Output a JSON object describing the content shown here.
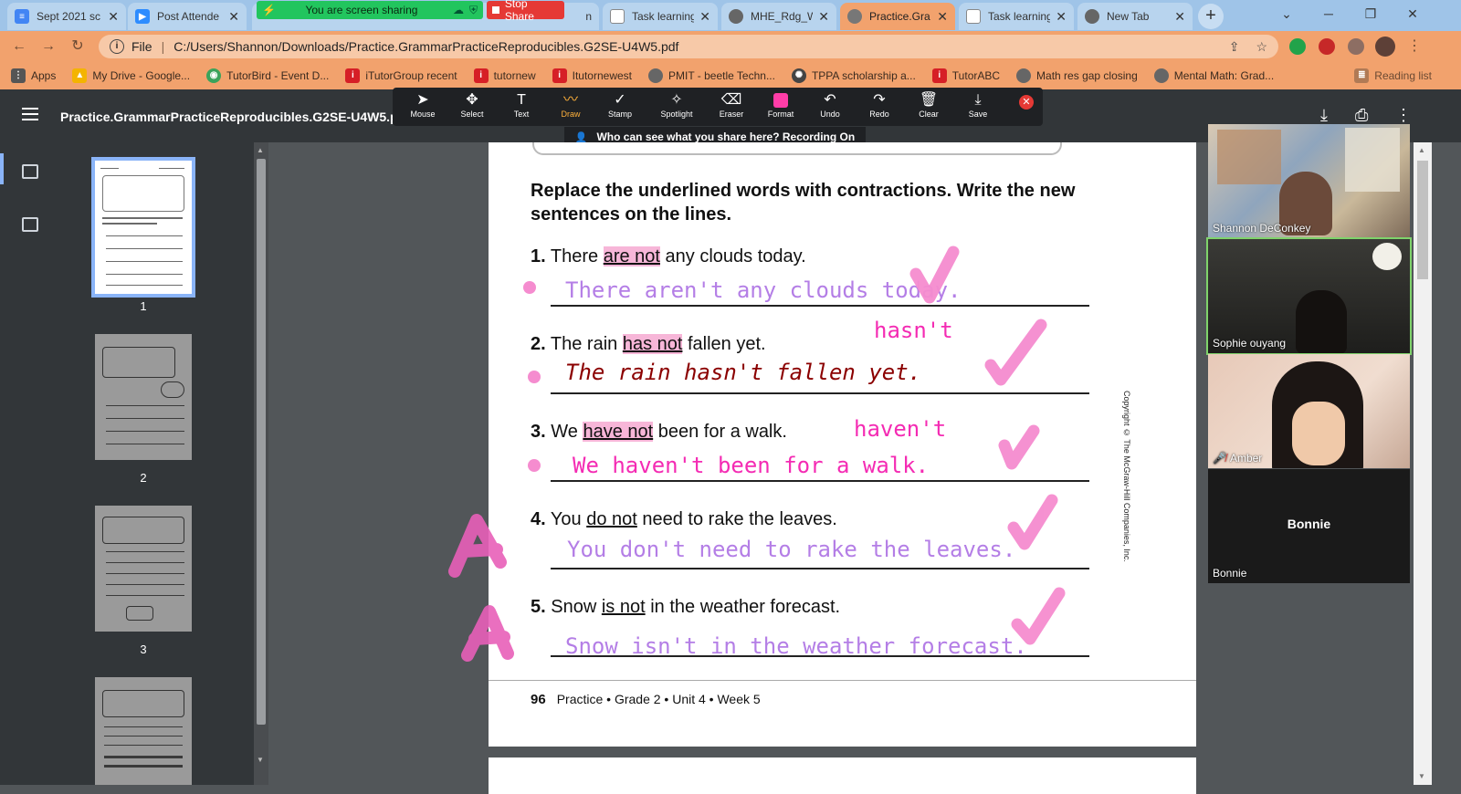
{
  "browser": {
    "tabs": [
      {
        "label": "Sept 2021 sc",
        "icon": "docs-icon",
        "color": "#4285f4"
      },
      {
        "label": "Post Attende",
        "icon": "zoom-icon",
        "color": "#2d8cff"
      },
      {
        "label": "n",
        "icon": "page-icon",
        "color": "#999999"
      },
      {
        "label": "Task learning",
        "icon": "doc-page-icon",
        "color": "#777777"
      },
      {
        "label": "MHE_Rdg_W",
        "icon": "globe-icon",
        "color": "#555555"
      },
      {
        "label": "Practice.Gra",
        "icon": "globe-icon",
        "color": "#555555"
      },
      {
        "label": "Task learning",
        "icon": "doc-page-icon",
        "color": "#777777"
      },
      {
        "label": "New Tab",
        "icon": "globe-icon",
        "color": "#555555"
      }
    ],
    "share_banner": "You are screen sharing",
    "stop_share": "Stop Share",
    "new_tab": "+",
    "address": {
      "scheme": "File",
      "path": "C:/Users/Shannon/Downloads/Practice.GrammarPracticeReproducibles.G2SE-U4W5.pdf"
    },
    "bookmarks": [
      {
        "label": "Apps",
        "icon": "apps-grid-icon",
        "color": "#555555"
      },
      {
        "label": "My Drive - Google...",
        "icon": "google-drive-icon",
        "color": "#f4b400"
      },
      {
        "label": "TutorBird - Event D...",
        "icon": "tutorbird-icon",
        "color": "#3aa35b"
      },
      {
        "label": "iTutorGroup recent",
        "icon": "itutor-icon",
        "color": "#d61f26"
      },
      {
        "label": "tutornew",
        "icon": "itutor-icon",
        "color": "#d61f26"
      },
      {
        "label": "Itutornewest",
        "icon": "itutor-icon",
        "color": "#d61f26"
      },
      {
        "label": "PMIT - beetle Techn...",
        "icon": "globe-icon",
        "color": "#666666"
      },
      {
        "label": "TPPA scholarship a...",
        "icon": "seal-icon",
        "color": "#444444"
      },
      {
        "label": "TutorABC",
        "icon": "itutor-icon",
        "color": "#d61f26"
      },
      {
        "label": "Math res gap closing",
        "icon": "globe-icon",
        "color": "#666666"
      },
      {
        "label": "Mental Math: Grad...",
        "icon": "globe-icon",
        "color": "#666666"
      }
    ],
    "reading_list": "Reading list"
  },
  "viewer": {
    "filename": "Practice.GrammarPracticeReproducibles.G2SE-U4W5.pdf",
    "thumbnails": [
      "1",
      "2",
      "3"
    ]
  },
  "annotation_toolbar": {
    "tools": [
      {
        "label": "Mouse",
        "icon": "cursor-icon",
        "glyph": "➤"
      },
      {
        "label": "Select",
        "icon": "move-icon",
        "glyph": "✥"
      },
      {
        "label": "Text",
        "icon": "text-icon",
        "glyph": "T"
      },
      {
        "label": "Draw",
        "icon": "draw-icon",
        "glyph": "〰"
      },
      {
        "label": "Stamp",
        "icon": "checkmark-icon",
        "glyph": "✓"
      },
      {
        "label": "Spotlight",
        "icon": "spotlight-icon",
        "glyph": "✧"
      },
      {
        "label": "Eraser",
        "icon": "eraser-icon",
        "glyph": "⌫"
      },
      {
        "label": "Format",
        "icon": "format-swatch-icon",
        "glyph": ""
      },
      {
        "label": "Undo",
        "icon": "undo-icon",
        "glyph": "↶"
      },
      {
        "label": "Redo",
        "icon": "redo-icon",
        "glyph": "↷"
      },
      {
        "label": "Clear",
        "icon": "trash-icon",
        "glyph": "🗑"
      },
      {
        "label": "Save",
        "icon": "save-icon",
        "glyph": "⤓"
      }
    ],
    "active_tool": "Draw",
    "format_color": "#ff3da8",
    "recording_banner": "Who can see what you share here? Recording On"
  },
  "page": {
    "instructions": "Replace the underlined words with contractions. Write the new sentences on the lines.",
    "questions": [
      {
        "num": "1.",
        "before": "There ",
        "underlined": "are not",
        "after": " any clouds today."
      },
      {
        "num": "2.",
        "before": "The rain ",
        "underlined": "has not",
        "after": " fallen yet."
      },
      {
        "num": "3.",
        "before": "We ",
        "underlined": "have not",
        "after": " been for a walk."
      },
      {
        "num": "4.",
        "before": "You ",
        "underlined": "do not",
        "after": " need to rake the leaves."
      },
      {
        "num": "5.",
        "before": "Snow ",
        "underlined": "is not",
        "after": " in the weather forecast."
      }
    ],
    "answers": [
      "There aren't any clouds today.",
      "The rain hasn't fallen yet.",
      "We haven't been for a walk.",
      "You don't need to rake the leaves.",
      "Snow isn't in the weather forecast."
    ],
    "notes": [
      "hasn't",
      "haven't"
    ],
    "copyright": "Copyright © The McGraw-Hill Companies, Inc.",
    "footer": {
      "page_number": "96",
      "text": "Practice • Grade 2 • Unit 4 • Week 5"
    },
    "colors": {
      "lavender": "#b47ee6",
      "magenta": "#f42bb3",
      "dark_red": "#8b0000",
      "highlight_pink": "#f7b6d8"
    }
  },
  "participants": [
    {
      "name": "Shannon DeConkey",
      "video": true
    },
    {
      "name": "Sophie ouyang",
      "video": true,
      "speaking": true
    },
    {
      "name": "Amber",
      "video": true,
      "muted": true
    },
    {
      "name": "Bonnie",
      "video": false
    }
  ]
}
